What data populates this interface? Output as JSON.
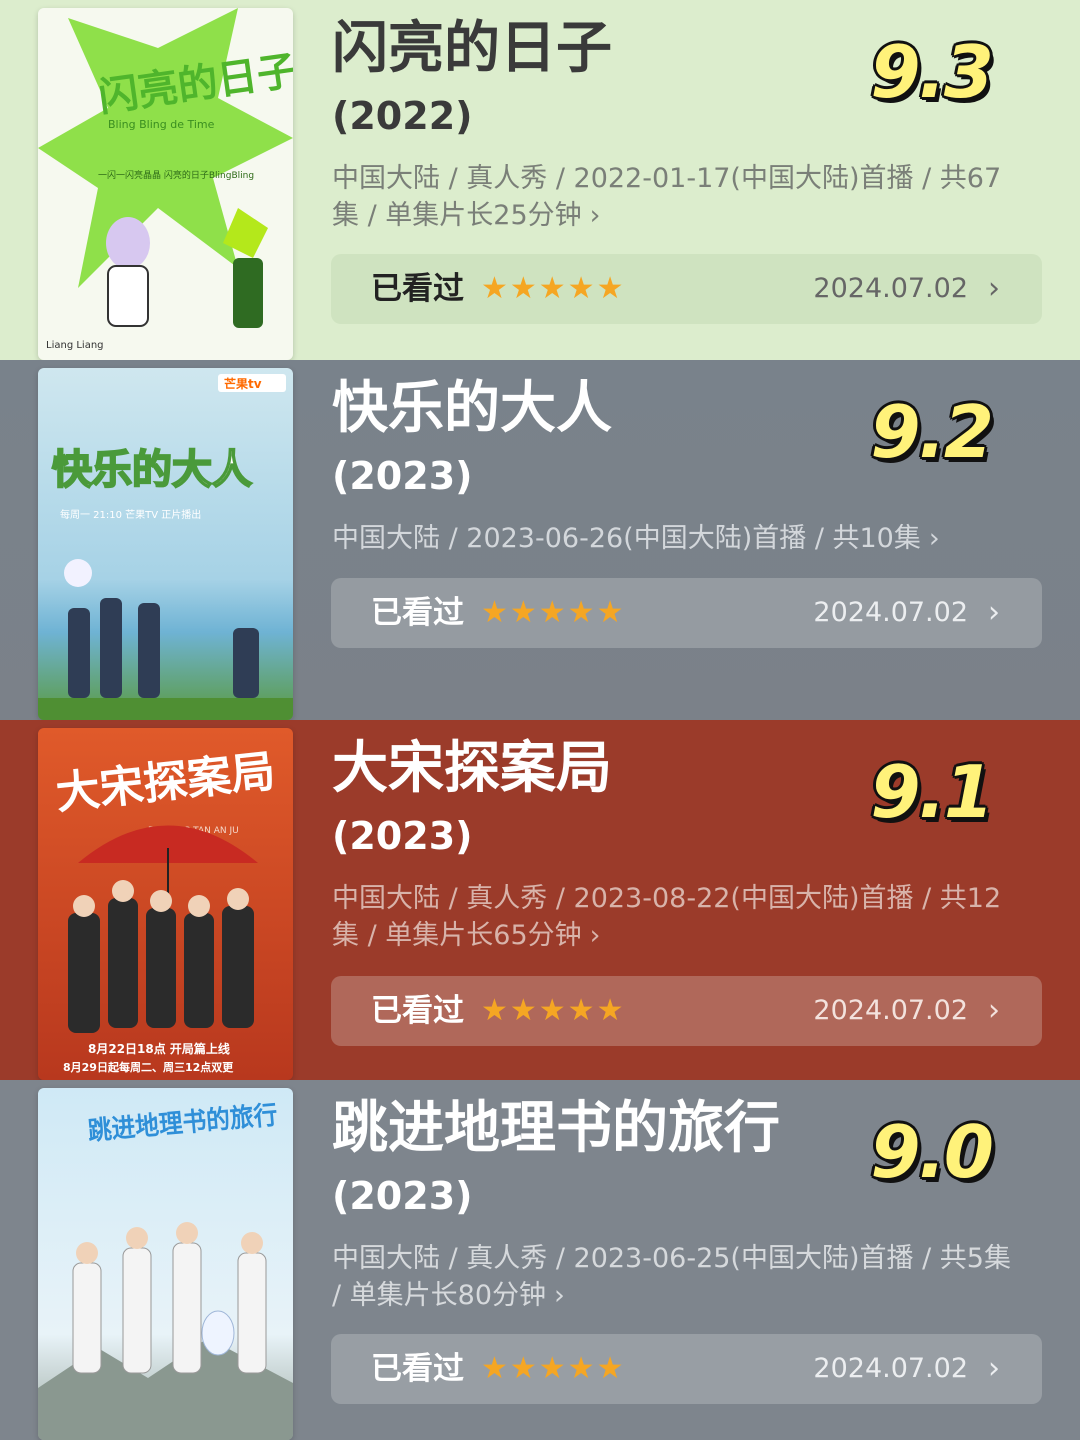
{
  "items": [
    {
      "title": "闪亮的日子",
      "year": "(2022)",
      "score": "9.3",
      "meta": "中国大陆 / 真人秀 / 2022-01-17(中国大陆)首播 / 共67集 / 单集片长25分钟",
      "status": "已看过",
      "stars": "★★★★★",
      "date": "2024.07.02",
      "poster": {
        "title_text": "闪亮的日子",
        "subtitle": "Bling Bling de Time",
        "tagline": "一闪一闪亮晶晶 闪亮的日子BlingBling",
        "badge_left": "Liang Liang"
      }
    },
    {
      "title": "快乐的大人",
      "year": "(2023)",
      "score": "9.2",
      "meta": "中国大陆 / 2023-06-26(中国大陆)首播 / 共10集",
      "status": "已看过",
      "stars": "★★★★★",
      "date": "2024.07.02",
      "poster": {
        "title_text": "快乐的大人",
        "brand": "芒果tv",
        "subtitle": "每周一 21:10 芒果TV 正片播出"
      }
    },
    {
      "title": "大宋探案局",
      "year": "(2023)",
      "score": "9.1",
      "meta": "中国大陆 / 真人秀 / 2023-08-22(中国大陆)首播 / 共12集 / 单集片长65分钟",
      "status": "已看过",
      "stars": "★★★★★",
      "date": "2024.07.02",
      "poster": {
        "title_text": "大宋探案局",
        "pinyin": "DA SONG TAN AN JU",
        "line1": "8月22日18点 开局篇上线",
        "line2": "8月29日起每周二、周三12点双更"
      }
    },
    {
      "title": "跳进地理书的旅行",
      "year": "(2023)",
      "score": "9.0",
      "meta": "中国大陆 / 真人秀 / 2023-06-25(中国大陆)首播 / 共5集 / 单集片长80分钟",
      "status": "已看过",
      "stars": "★★★★★",
      "date": "2024.07.02",
      "poster": {
        "title_text": "跳进地理书的旅行"
      }
    }
  ],
  "icons": {
    "chevron": "›",
    "star": "★"
  },
  "colors": {
    "score_fill": "#fff27a",
    "star": "#f5a623",
    "card1_bg": "#dcedcd",
    "card2_bg": "#7b8189",
    "card3_bg": "#9b3b2a",
    "card4_bg": "#7e858d"
  }
}
